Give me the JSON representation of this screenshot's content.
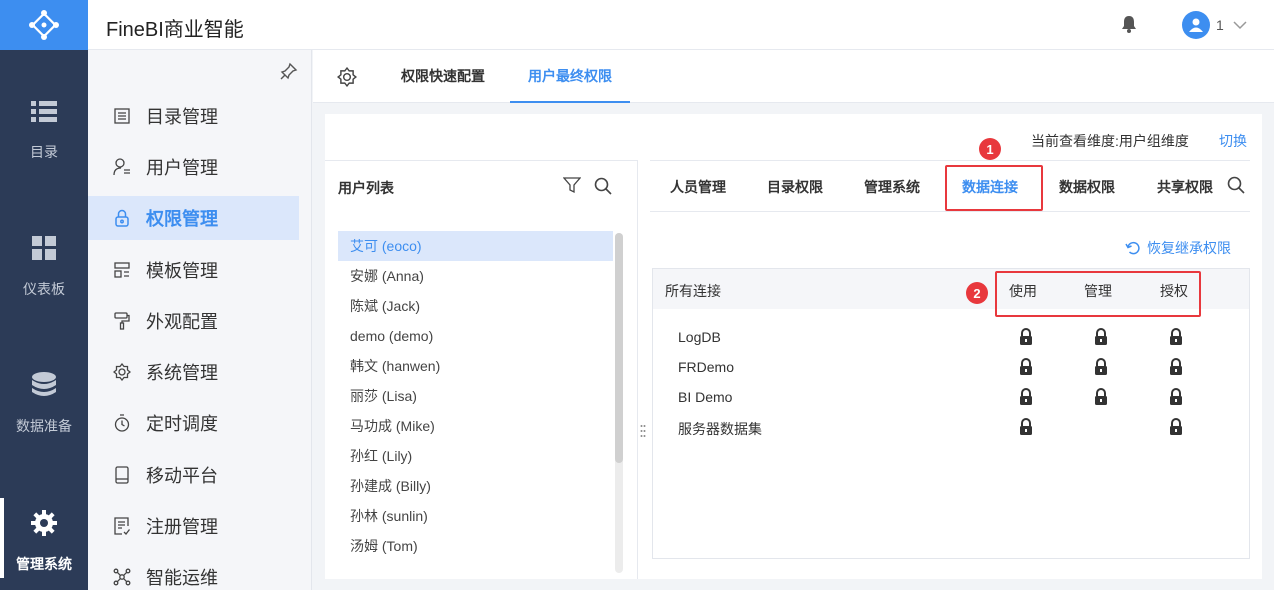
{
  "app": {
    "title": "FineBI商业智能"
  },
  "header": {
    "user_name": "1"
  },
  "rail": [
    {
      "label": "目录",
      "icon": "list-icon"
    },
    {
      "label": "仪表板",
      "icon": "dashboard-icon"
    },
    {
      "label": "数据准备",
      "icon": "database-icon"
    },
    {
      "label": "管理系统",
      "icon": "gear-icon",
      "active": true
    }
  ],
  "submenu": [
    {
      "label": "目录管理",
      "icon": "catalog-icon"
    },
    {
      "label": "用户管理",
      "icon": "user-icon"
    },
    {
      "label": "权限管理",
      "icon": "lock-icon",
      "active": true
    },
    {
      "label": "模板管理",
      "icon": "template-icon"
    },
    {
      "label": "外观配置",
      "icon": "brush-icon"
    },
    {
      "label": "系统管理",
      "icon": "settings-icon"
    },
    {
      "label": "定时调度",
      "icon": "timer-icon"
    },
    {
      "label": "移动平台",
      "icon": "mobile-icon"
    },
    {
      "label": "注册管理",
      "icon": "register-icon"
    },
    {
      "label": "智能运维",
      "icon": "network-icon"
    }
  ],
  "tabs": [
    {
      "label": "权限快速配置"
    },
    {
      "label": "用户最终权限",
      "active": true
    }
  ],
  "dimension": {
    "label": "当前查看维度:用户组维度",
    "switch": "切换"
  },
  "user_panel": {
    "title": "用户列表",
    "users": [
      "艾可 (eoco)",
      "安娜 (Anna)",
      "陈斌 (Jack)",
      "demo (demo)",
      "韩文 (hanwen)",
      "丽莎 (Lisa)",
      "马功成 (Mike)",
      "孙红 (Lily)",
      "孙建成 (Billy)",
      "孙林 (sunlin)",
      "汤姆 (Tom)"
    ],
    "selected_index": 0
  },
  "perm_tabs": [
    {
      "label": "人员管理"
    },
    {
      "label": "目录权限"
    },
    {
      "label": "管理系统"
    },
    {
      "label": "数据连接",
      "active": true
    },
    {
      "label": "数据权限"
    },
    {
      "label": "共享权限"
    }
  ],
  "restore_label": "恢复继承权限",
  "table": {
    "header": {
      "name": "所有连接",
      "use": "使用",
      "manage": "管理",
      "grant": "授权"
    },
    "rows": [
      {
        "name": "LogDB",
        "use": true,
        "manage": true,
        "grant": true
      },
      {
        "name": "FRDemo",
        "use": true,
        "manage": true,
        "grant": true
      },
      {
        "name": "BI Demo",
        "use": true,
        "manage": true,
        "grant": true
      },
      {
        "name": "服务器数据集",
        "use": true,
        "manage": false,
        "grant": true
      }
    ]
  },
  "annotations": [
    "1",
    "2"
  ],
  "colors": {
    "accent": "#3d8ef0",
    "rail": "#2c3b57",
    "highlight": "#e8383d"
  }
}
